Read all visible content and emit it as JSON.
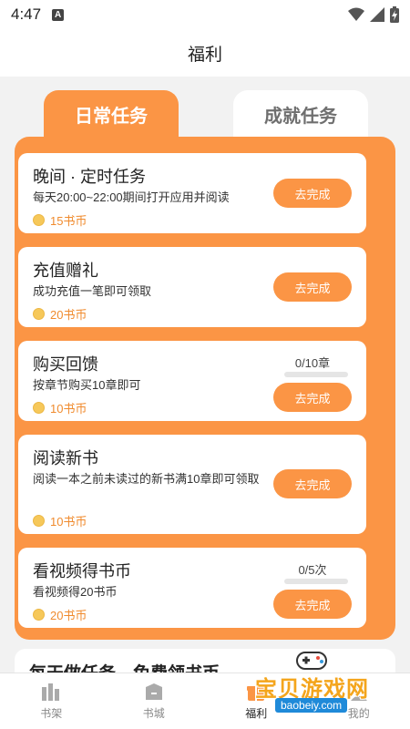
{
  "status": {
    "time": "4:47"
  },
  "header": {
    "title": "福利"
  },
  "tabs": {
    "daily": "日常任务",
    "achievement": "成就任务"
  },
  "tasks": [
    {
      "title": "晚间 · 定时任务",
      "desc": "每天20:00~22:00期间打开应用并阅读",
      "reward": "15书币",
      "button": "去完成"
    },
    {
      "title": "充值赠礼",
      "desc": "成功充值一笔即可领取",
      "reward": "20书币",
      "button": "去完成"
    },
    {
      "title": "购买回馈",
      "desc": "按章节购买10章即可",
      "reward": "10书币",
      "button": "去完成",
      "progress": "0/10章",
      "progress_fraction": 0
    },
    {
      "title": "阅读新书",
      "desc": "阅读一本之前未读过的新书满10章即可领取",
      "reward": "10书币",
      "button": "去完成"
    },
    {
      "title": "看视频得书币",
      "desc": "看视频得20书币",
      "reward": "20书币",
      "button": "去完成",
      "progress": "0/5次",
      "progress_fraction": 0
    }
  ],
  "bottom_card": {
    "title": "每天做任务，免费领书币"
  },
  "nav": [
    {
      "label": "书架",
      "icon": "bookshelf-icon"
    },
    {
      "label": "书城",
      "icon": "bookstore-icon"
    },
    {
      "label": "福利",
      "icon": "gift-icon"
    },
    {
      "label": "我的",
      "icon": "profile-icon"
    }
  ],
  "watermark": {
    "text": "宝贝游戏网",
    "url": "baobeiy.com"
  },
  "colors": {
    "accent": "#fb9545",
    "coin": "#f6c85a",
    "reward_text": "#f08b2e"
  }
}
